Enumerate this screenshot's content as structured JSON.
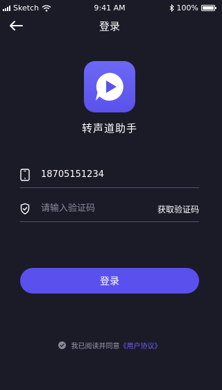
{
  "status_bar": {
    "carrier": "Sketch",
    "time": "9:41 AM",
    "battery": "100%",
    "battery_level": 1.0
  },
  "nav": {
    "title": "登录",
    "back_icon": "arrow-left-icon"
  },
  "app": {
    "name": "转声道助手",
    "logo_icon": "play-bubble-icon"
  },
  "phone": {
    "icon": "mobile-phone-icon",
    "value": "18705151234"
  },
  "code": {
    "icon": "shield-check-icon",
    "placeholder": "请输入验证码",
    "get_code_label": "获取验证码"
  },
  "login_button_label": "登录",
  "agreement": {
    "icon": "check-circle-icon",
    "text": "我已阅读并同意",
    "link": "《用户协议》"
  },
  "colors": {
    "background": "#1b1b28",
    "accent": "#5a50ee",
    "link": "#6a60f2"
  }
}
